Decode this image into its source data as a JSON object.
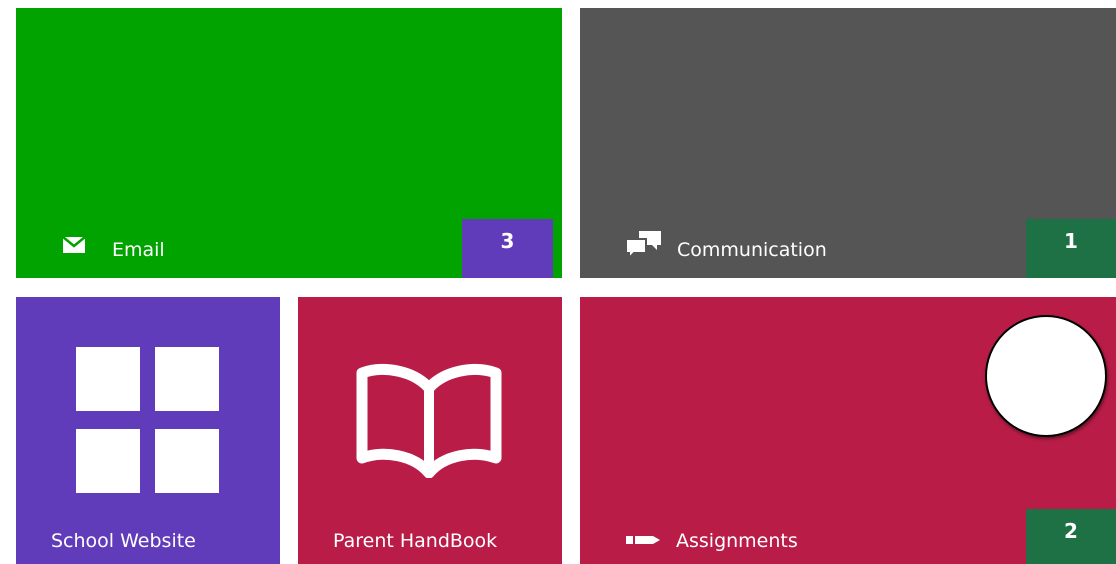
{
  "colors": {
    "email_tile": "#00a300",
    "communication_tile": "#555555",
    "website_tile": "#603cba",
    "handbook_tile": "#b91d47",
    "assignments_tile": "#b91d47",
    "purple_badge": "#603cba",
    "green_badge": "#1e7145"
  },
  "tiles": {
    "email": {
      "label": "Email",
      "badge": "3",
      "icon": "envelope-icon"
    },
    "communication": {
      "label": "Communication",
      "badge": "1",
      "icon": "chat-bubbles-icon"
    },
    "school_website": {
      "label": "School Website",
      "icon": "windows-grid-icon"
    },
    "parent_handbook": {
      "label": "Parent HandBook",
      "icon": "open-book-icon"
    },
    "assignments": {
      "label": "Assignments",
      "badge": "2",
      "icon": "pencil-icon"
    }
  }
}
